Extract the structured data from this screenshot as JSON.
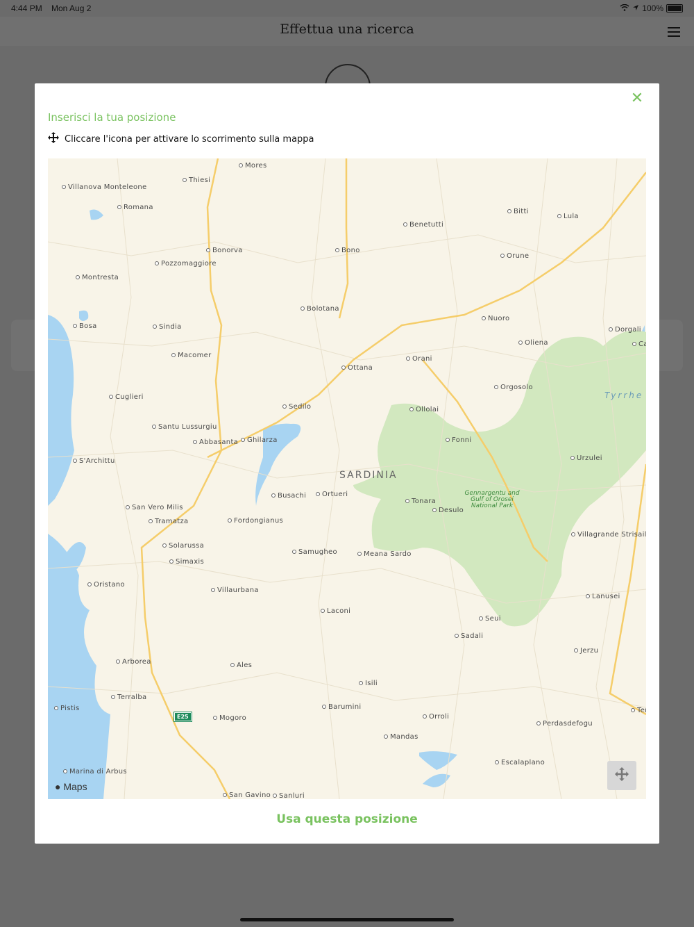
{
  "status_bar": {
    "time": "4:44 PM",
    "date": "Mon Aug 2",
    "battery": "100%"
  },
  "header": {
    "title": "Effettua una ricerca"
  },
  "modal": {
    "title": "Inserisci la tua posizione",
    "instruction": "Cliccare l'icona per attivare lo scorrimento sulla mappa",
    "action_label": "Usa questa posizione"
  },
  "map": {
    "region_label": "SARDINIA",
    "sea_label": "Tyrrhe",
    "park_label": "Gennargentu and Gulf of Orosei National Park",
    "road_shield": "E25",
    "attribution": "Maps",
    "cities": [
      {
        "name": "Mores"
      },
      {
        "name": "Thiesi"
      },
      {
        "name": "Villanova Monteleone"
      },
      {
        "name": "Romana"
      },
      {
        "name": "Bitti"
      },
      {
        "name": "Lula"
      },
      {
        "name": "Benetutti"
      },
      {
        "name": "Bonorva"
      },
      {
        "name": "Bono"
      },
      {
        "name": "Pozzomaggiore"
      },
      {
        "name": "Orune"
      },
      {
        "name": "Montresta"
      },
      {
        "name": "Bolotana"
      },
      {
        "name": "Nuoro"
      },
      {
        "name": "Dorgali"
      },
      {
        "name": "Cal"
      },
      {
        "name": "Bosa"
      },
      {
        "name": "Sindia"
      },
      {
        "name": "Oliena"
      },
      {
        "name": "Macomer"
      },
      {
        "name": "Orani"
      },
      {
        "name": "Ottana"
      },
      {
        "name": "Orgosolo"
      },
      {
        "name": "Cuglieri"
      },
      {
        "name": "Sedilo"
      },
      {
        "name": "Ollolai"
      },
      {
        "name": "Santu Lussurgiu"
      },
      {
        "name": "Abbasanta"
      },
      {
        "name": "Ghilarza"
      },
      {
        "name": "Fonni"
      },
      {
        "name": "S'Archittu"
      },
      {
        "name": "Urzulei"
      },
      {
        "name": "Busachi"
      },
      {
        "name": "Ortueri"
      },
      {
        "name": "San Vero Milis"
      },
      {
        "name": "Tonara"
      },
      {
        "name": "Desulo"
      },
      {
        "name": "Tramatza"
      },
      {
        "name": "Fordongianus"
      },
      {
        "name": "Villagrande Strisaili"
      },
      {
        "name": "Solarussa"
      },
      {
        "name": "Samugheo"
      },
      {
        "name": "Meana Sardo"
      },
      {
        "name": "Simaxis"
      },
      {
        "name": "Oristano"
      },
      {
        "name": "Villaurbana"
      },
      {
        "name": "Lanusei"
      },
      {
        "name": "Laconi"
      },
      {
        "name": "Seui"
      },
      {
        "name": "Sadali"
      },
      {
        "name": "Jerzu"
      },
      {
        "name": "Arborea"
      },
      {
        "name": "Ales"
      },
      {
        "name": "Isili"
      },
      {
        "name": "Terralba"
      },
      {
        "name": "Pistis"
      },
      {
        "name": "Mogoro"
      },
      {
        "name": "Barumini"
      },
      {
        "name": "Tertenia"
      },
      {
        "name": "Orroli"
      },
      {
        "name": "Perdasdefogu"
      },
      {
        "name": "Mandas"
      },
      {
        "name": "Escalaplano"
      },
      {
        "name": "Marina di Arbus"
      },
      {
        "name": "San Gavino"
      },
      {
        "name": "Sanluri"
      }
    ]
  }
}
